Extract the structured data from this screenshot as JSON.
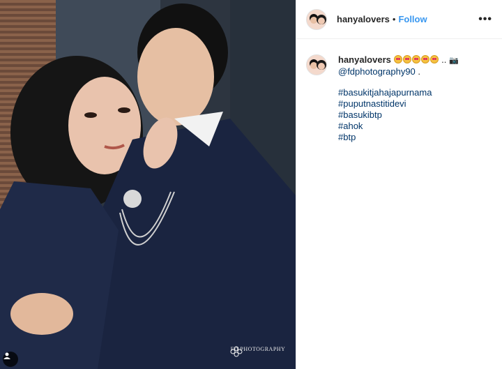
{
  "post": {
    "username": "hanyalovers",
    "separator": "•",
    "follow_label": "Follow",
    "more_icon": "more-options-icon"
  },
  "caption": {
    "username": "hanyalovers",
    "emoji_count": 5,
    "ellipsis": "..",
    "mention": "@fdphotography90",
    "mention_suffix": ".",
    "hashtags": [
      "#basukitjahajapurnama",
      "#puputnastitidevi",
      "#basukibtp",
      "#ahok",
      "#btp"
    ]
  },
  "photo": {
    "watermark": "FD PHOTOGRAPHY",
    "tag_icon": "user-tag-icon"
  },
  "colors": {
    "link": "#003569",
    "follow": "#3897f0",
    "text": "#262626"
  }
}
